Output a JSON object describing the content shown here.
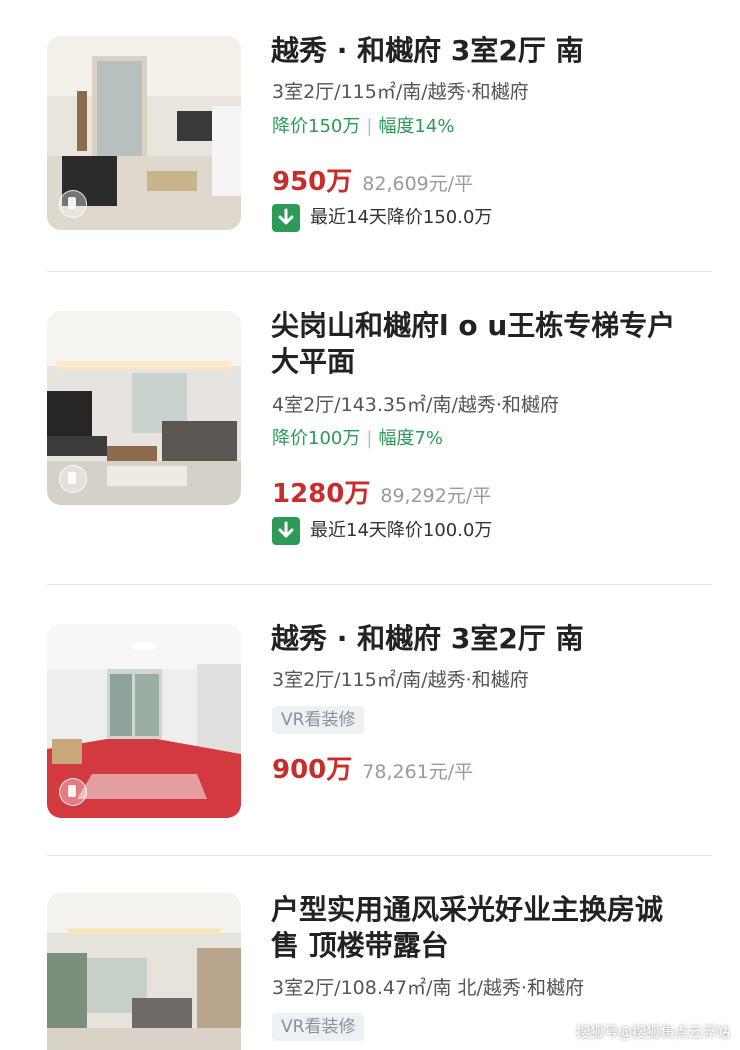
{
  "listings": [
    {
      "title": "越秀 · 和樾府 3室2厅 南",
      "spec": "3室2厅/115㎡/南/越秀·和樾府",
      "drop_amount": "降价150万",
      "drop_rate": "幅度14%",
      "price": "950万",
      "unit_price": "82,609元/平",
      "recent": "最近14天降价150.0万"
    },
    {
      "title_line1": "尖岗山和樾府l o u王栋专梯专户",
      "title_line2": "大平面",
      "spec": "4室2厅/143.35㎡/南/越秀·和樾府",
      "drop_amount": "降价100万",
      "drop_rate": "幅度7%",
      "price": "1280万",
      "unit_price": "89,292元/平",
      "recent": "最近14天降价100.0万"
    },
    {
      "title": "越秀 · 和樾府 3室2厅 南",
      "spec": "3室2厅/115㎡/南/越秀·和樾府",
      "tag": "VR看装修",
      "price": "900万",
      "unit_price": "78,261元/平"
    },
    {
      "title_line1": "户型实用通风采光好业主换房诚",
      "title_line2": "售 顶楼带露台",
      "spec": "3室2厅/108.47㎡/南 北/越秀·和樾府",
      "tag": "VR看装修"
    }
  ],
  "drop_separator": "|",
  "watermark": "搜狐号@搜狐焦点云浮站",
  "colors": {
    "price": "#c72d2d",
    "drop": "#2d9a57",
    "tag_bg": "#eef1f3"
  },
  "icons": {
    "down": "arrow-down-icon",
    "vr": "vr-icon"
  }
}
